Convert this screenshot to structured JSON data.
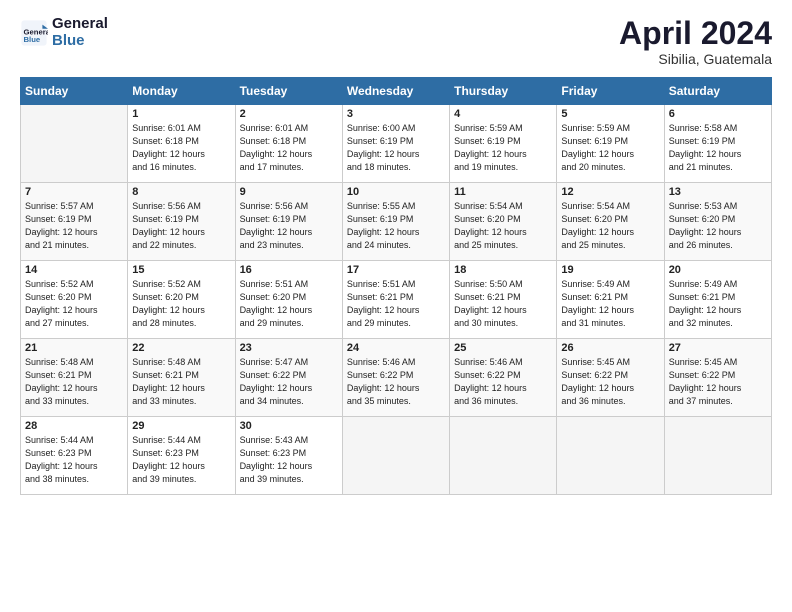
{
  "header": {
    "logo_line1": "General",
    "logo_line2": "Blue",
    "month": "April 2024",
    "location": "Sibilia, Guatemala"
  },
  "days_of_week": [
    "Sunday",
    "Monday",
    "Tuesday",
    "Wednesday",
    "Thursday",
    "Friday",
    "Saturday"
  ],
  "weeks": [
    [
      {
        "day": "",
        "info": ""
      },
      {
        "day": "1",
        "info": "Sunrise: 6:01 AM\nSunset: 6:18 PM\nDaylight: 12 hours\nand 16 minutes."
      },
      {
        "day": "2",
        "info": "Sunrise: 6:01 AM\nSunset: 6:18 PM\nDaylight: 12 hours\nand 17 minutes."
      },
      {
        "day": "3",
        "info": "Sunrise: 6:00 AM\nSunset: 6:19 PM\nDaylight: 12 hours\nand 18 minutes."
      },
      {
        "day": "4",
        "info": "Sunrise: 5:59 AM\nSunset: 6:19 PM\nDaylight: 12 hours\nand 19 minutes."
      },
      {
        "day": "5",
        "info": "Sunrise: 5:59 AM\nSunset: 6:19 PM\nDaylight: 12 hours\nand 20 minutes."
      },
      {
        "day": "6",
        "info": "Sunrise: 5:58 AM\nSunset: 6:19 PM\nDaylight: 12 hours\nand 21 minutes."
      }
    ],
    [
      {
        "day": "7",
        "info": "Sunrise: 5:57 AM\nSunset: 6:19 PM\nDaylight: 12 hours\nand 21 minutes."
      },
      {
        "day": "8",
        "info": "Sunrise: 5:56 AM\nSunset: 6:19 PM\nDaylight: 12 hours\nand 22 minutes."
      },
      {
        "day": "9",
        "info": "Sunrise: 5:56 AM\nSunset: 6:19 PM\nDaylight: 12 hours\nand 23 minutes."
      },
      {
        "day": "10",
        "info": "Sunrise: 5:55 AM\nSunset: 6:19 PM\nDaylight: 12 hours\nand 24 minutes."
      },
      {
        "day": "11",
        "info": "Sunrise: 5:54 AM\nSunset: 6:20 PM\nDaylight: 12 hours\nand 25 minutes."
      },
      {
        "day": "12",
        "info": "Sunrise: 5:54 AM\nSunset: 6:20 PM\nDaylight: 12 hours\nand 25 minutes."
      },
      {
        "day": "13",
        "info": "Sunrise: 5:53 AM\nSunset: 6:20 PM\nDaylight: 12 hours\nand 26 minutes."
      }
    ],
    [
      {
        "day": "14",
        "info": "Sunrise: 5:52 AM\nSunset: 6:20 PM\nDaylight: 12 hours\nand 27 minutes."
      },
      {
        "day": "15",
        "info": "Sunrise: 5:52 AM\nSunset: 6:20 PM\nDaylight: 12 hours\nand 28 minutes."
      },
      {
        "day": "16",
        "info": "Sunrise: 5:51 AM\nSunset: 6:20 PM\nDaylight: 12 hours\nand 29 minutes."
      },
      {
        "day": "17",
        "info": "Sunrise: 5:51 AM\nSunset: 6:21 PM\nDaylight: 12 hours\nand 29 minutes."
      },
      {
        "day": "18",
        "info": "Sunrise: 5:50 AM\nSunset: 6:21 PM\nDaylight: 12 hours\nand 30 minutes."
      },
      {
        "day": "19",
        "info": "Sunrise: 5:49 AM\nSunset: 6:21 PM\nDaylight: 12 hours\nand 31 minutes."
      },
      {
        "day": "20",
        "info": "Sunrise: 5:49 AM\nSunset: 6:21 PM\nDaylight: 12 hours\nand 32 minutes."
      }
    ],
    [
      {
        "day": "21",
        "info": "Sunrise: 5:48 AM\nSunset: 6:21 PM\nDaylight: 12 hours\nand 33 minutes."
      },
      {
        "day": "22",
        "info": "Sunrise: 5:48 AM\nSunset: 6:21 PM\nDaylight: 12 hours\nand 33 minutes."
      },
      {
        "day": "23",
        "info": "Sunrise: 5:47 AM\nSunset: 6:22 PM\nDaylight: 12 hours\nand 34 minutes."
      },
      {
        "day": "24",
        "info": "Sunrise: 5:46 AM\nSunset: 6:22 PM\nDaylight: 12 hours\nand 35 minutes."
      },
      {
        "day": "25",
        "info": "Sunrise: 5:46 AM\nSunset: 6:22 PM\nDaylight: 12 hours\nand 36 minutes."
      },
      {
        "day": "26",
        "info": "Sunrise: 5:45 AM\nSunset: 6:22 PM\nDaylight: 12 hours\nand 36 minutes."
      },
      {
        "day": "27",
        "info": "Sunrise: 5:45 AM\nSunset: 6:22 PM\nDaylight: 12 hours\nand 37 minutes."
      }
    ],
    [
      {
        "day": "28",
        "info": "Sunrise: 5:44 AM\nSunset: 6:23 PM\nDaylight: 12 hours\nand 38 minutes."
      },
      {
        "day": "29",
        "info": "Sunrise: 5:44 AM\nSunset: 6:23 PM\nDaylight: 12 hours\nand 39 minutes."
      },
      {
        "day": "30",
        "info": "Sunrise: 5:43 AM\nSunset: 6:23 PM\nDaylight: 12 hours\nand 39 minutes."
      },
      {
        "day": "",
        "info": ""
      },
      {
        "day": "",
        "info": ""
      },
      {
        "day": "",
        "info": ""
      },
      {
        "day": "",
        "info": ""
      }
    ]
  ]
}
